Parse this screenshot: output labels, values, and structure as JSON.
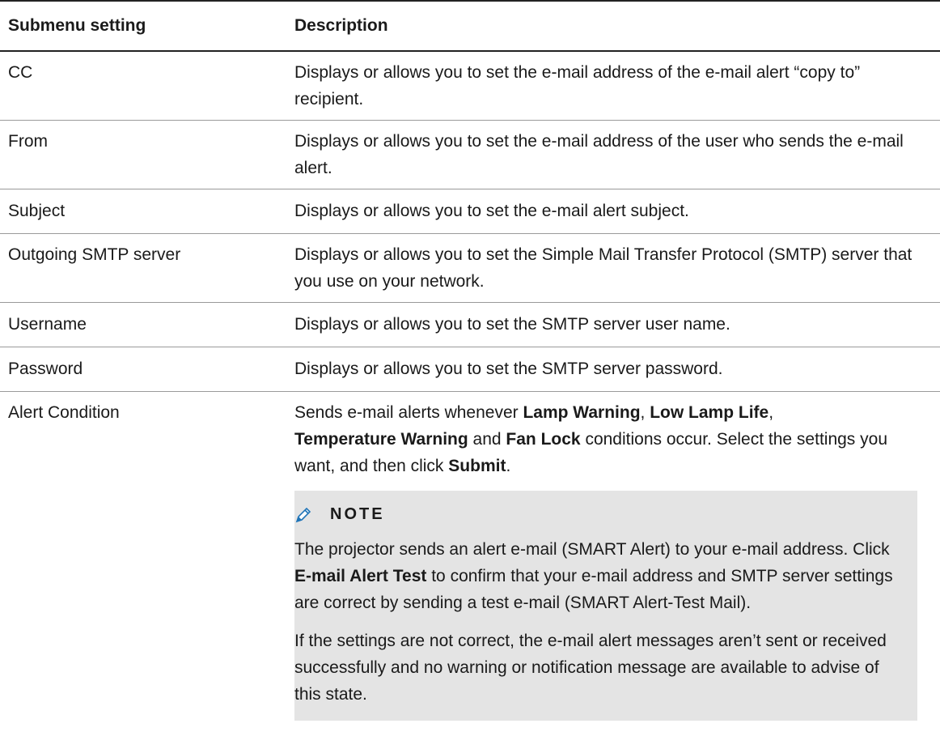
{
  "table": {
    "headers": {
      "setting": "Submenu setting",
      "description": "Description"
    },
    "rows": [
      {
        "setting": "CC",
        "description": "Displays or allows you to set the e-mail address of the e-mail alert “copy to” recipient."
      },
      {
        "setting": "From",
        "description": "Displays or allows you to set the e-mail address of the user who sends the e-mail alert."
      },
      {
        "setting": "Subject",
        "description": "Displays or allows you to set the e-mail alert subject."
      },
      {
        "setting": "Outgoing SMTP server",
        "description": "Displays or allows you to set the Simple Mail Transfer Protocol (SMTP) server that you use on your network."
      },
      {
        "setting": "Username",
        "description": "Displays or allows you to set the SMTP server user name."
      },
      {
        "setting": "Password",
        "description": "Displays or allows you to set the SMTP server password."
      }
    ],
    "alert_row": {
      "setting": "Alert Condition",
      "desc_part1": "Sends e-mail alerts whenever ",
      "lamp_warning": "Lamp Warning",
      "sep1": ", ",
      "low_lamp_life": "Low Lamp Life",
      "sep2": ",",
      "temperature_warning": "Temperature Warning",
      "and": " and ",
      "fan_lock": "Fan Lock",
      "desc_part2": " conditions occur. Select the settings you want, and then click ",
      "submit": "Submit",
      "period": "."
    }
  },
  "note": {
    "icon": "pencil-icon",
    "title": "NOTE",
    "p1_part1": "The projector sends an alert e-mail (SMART Alert) to your e-mail address. Click ",
    "p1_bold": "E-mail Alert Test",
    "p1_part2": " to confirm that your e-mail address and SMTP server settings are correct by sending a test e-mail (SMART Alert-Test Mail).",
    "p2": "If the settings are not correct, the e-mail alert messages aren’t sent or received successfully and no warning or notification message are available to advise of this state."
  },
  "colors": {
    "note_background": "#e4e4e4",
    "icon_blue": "#1f74b8"
  }
}
